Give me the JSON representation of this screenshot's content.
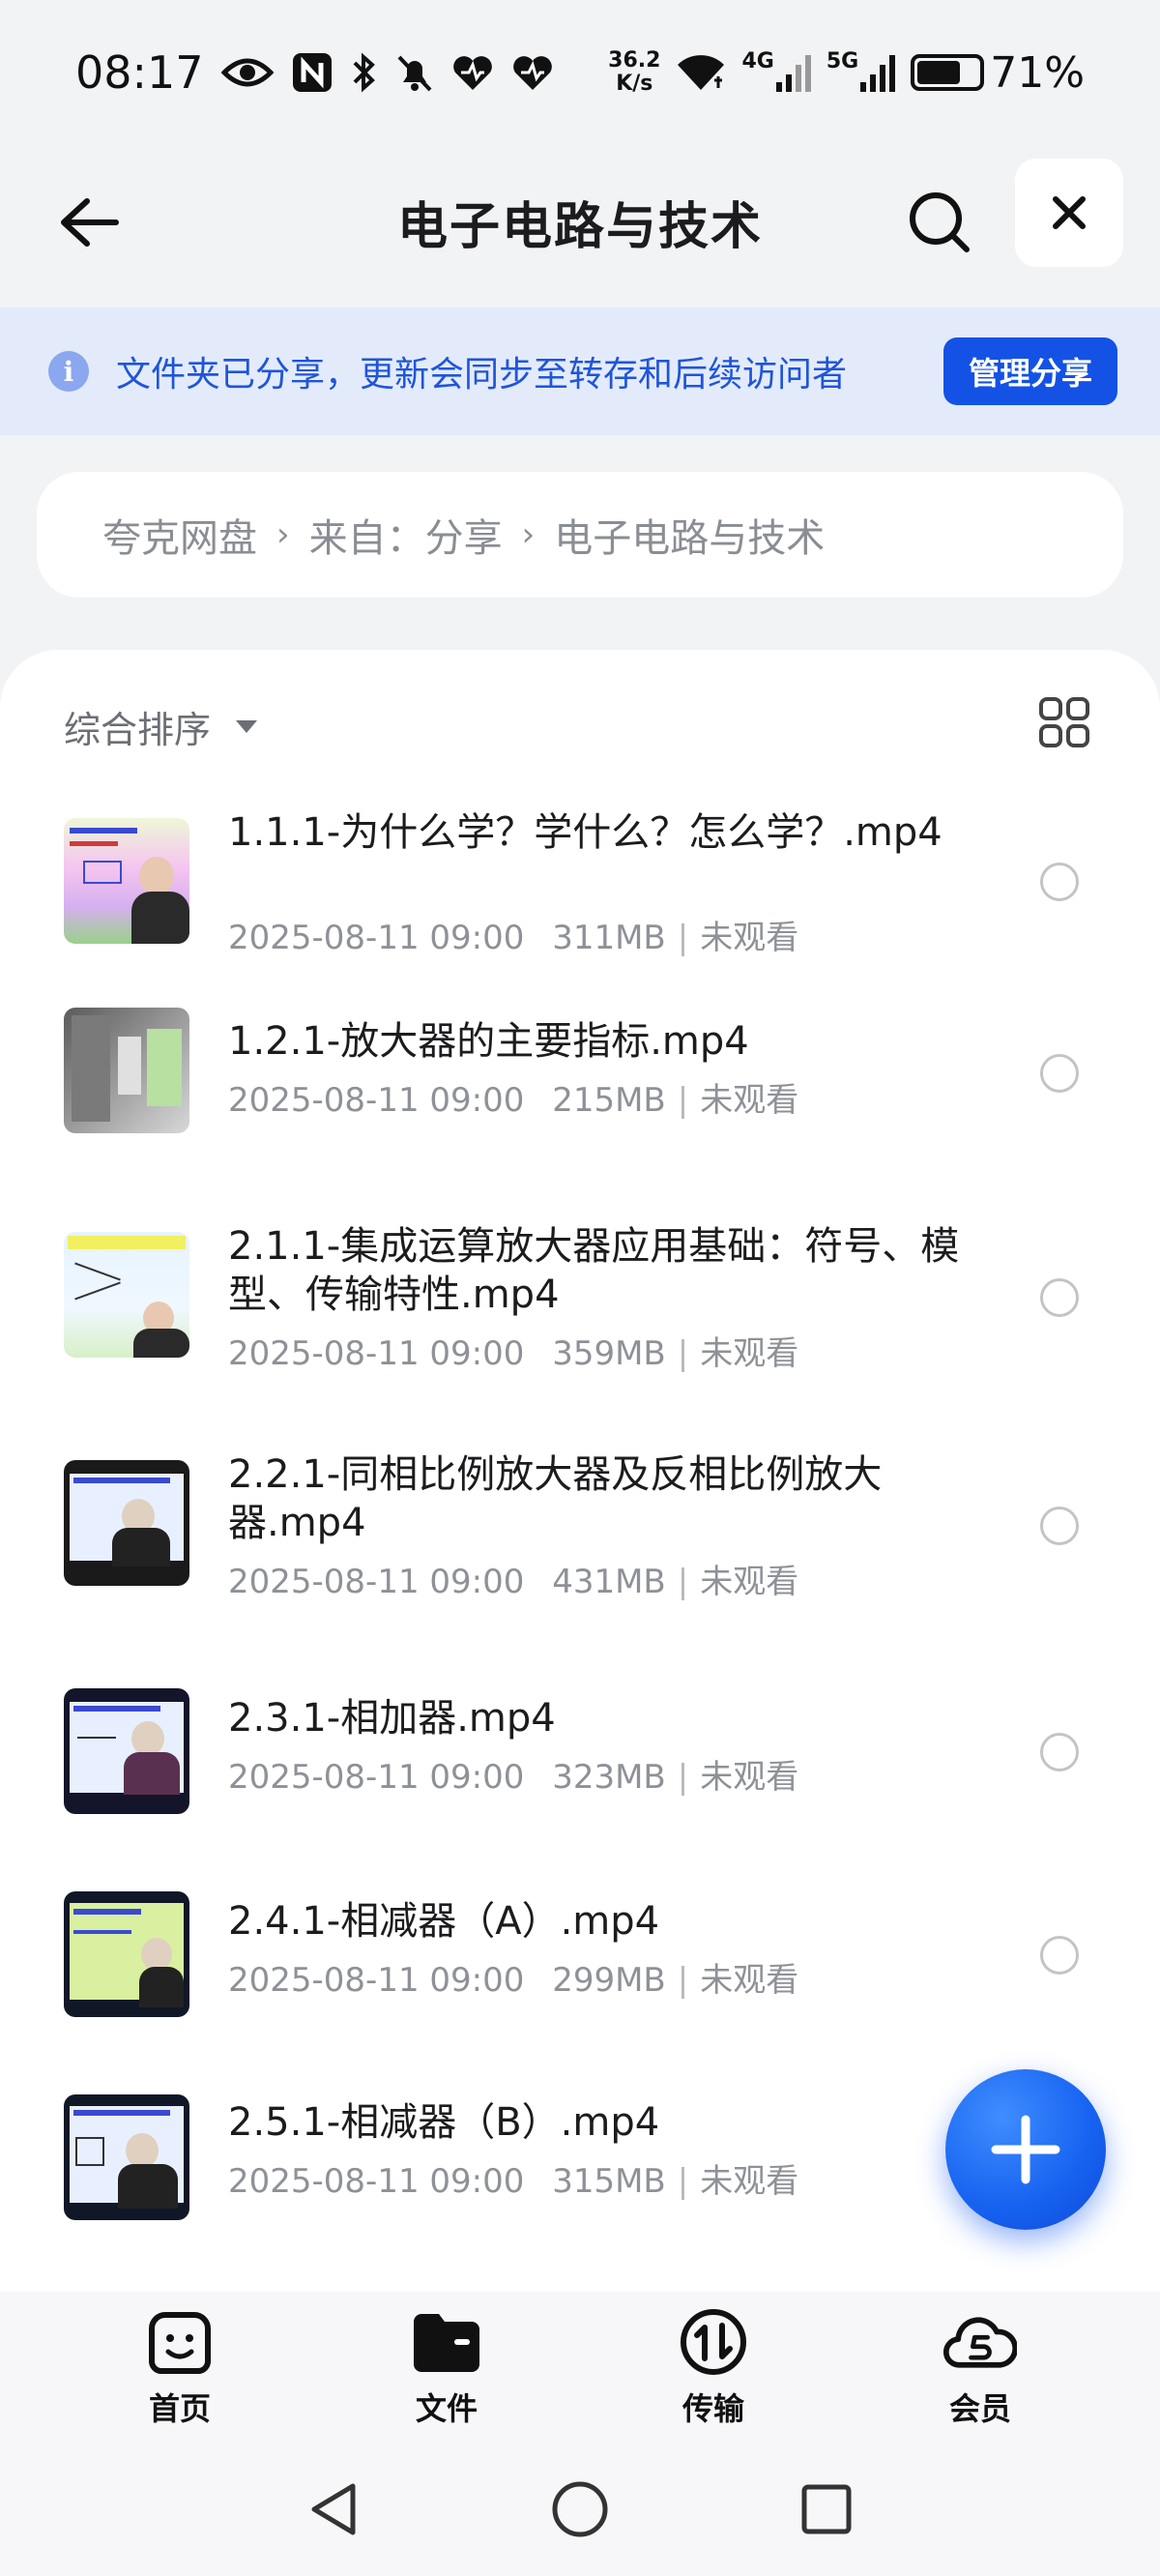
{
  "status_bar": {
    "time": "08:17",
    "net_speed_value": "36.2",
    "net_speed_unit": "K/s",
    "network_4g": "4G",
    "network_5g": "5G",
    "battery": "71%",
    "battery_level": 0.71
  },
  "header": {
    "title": "电子电路与技术"
  },
  "share_banner": {
    "text": "文件夹已分享，更新会同步至转存和后续访问者",
    "button_label": "管理分享"
  },
  "breadcrumb": {
    "items": [
      "夸克网盘",
      "来自：分享",
      "电子电路与技术"
    ]
  },
  "sort": {
    "label": "综合排序"
  },
  "files": [
    {
      "name": "1.1.1-为什么学？学什么？怎么学？.mp4",
      "date": "2025-08-11 09:00",
      "size": "311MB",
      "status": "未观看"
    },
    {
      "name": "1.2.1-放大器的主要指标.mp4",
      "date": "2025-08-11 09:00",
      "size": "215MB",
      "status": "未观看"
    },
    {
      "name": "2.1.1-集成运算放大器应用基础：符号、模型、传输特性.mp4",
      "date": "2025-08-11 09:00",
      "size": "359MB",
      "status": "未观看"
    },
    {
      "name": "2.2.1-同相比例放大器及反相比例放大器.mp4",
      "date": "2025-08-11 09:00",
      "size": "431MB",
      "status": "未观看"
    },
    {
      "name": "2.3.1-相加器.mp4",
      "date": "2025-08-11 09:00",
      "size": "323MB",
      "status": "未观看"
    },
    {
      "name": "2.4.1-相减器（A）.mp4",
      "date": "2025-08-11 09:00",
      "size": "299MB",
      "status": "未观看"
    },
    {
      "name": "2.5.1-相减器（B）.mp4",
      "date": "2025-08-11 09:00",
      "size": "315MB",
      "status": "未观看"
    }
  ],
  "bottom_nav": {
    "items": [
      {
        "label": "首页",
        "icon": "home-face-icon"
      },
      {
        "label": "文件",
        "icon": "folder-icon"
      },
      {
        "label": "传输",
        "icon": "transfer-icon"
      },
      {
        "label": "会员",
        "icon": "vip-cloud-icon"
      }
    ]
  },
  "colors": {
    "accent": "#1452e6",
    "banner_bg": "#e3ebfb",
    "banner_text": "#1f55d9"
  }
}
